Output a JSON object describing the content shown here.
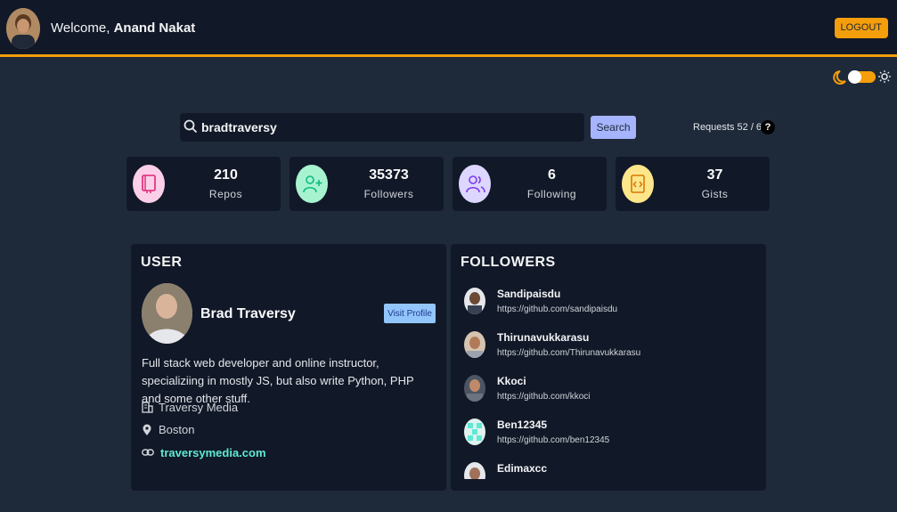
{
  "header": {
    "welcome_prefix": "Welcome,",
    "user_name": "Anand Nakat",
    "logout_label": "LOGOUT"
  },
  "theme": {
    "mode": "dark",
    "accent": "#f59e0b"
  },
  "search": {
    "value": "bradtraversy",
    "button_label": "Search",
    "requests_text": "Requests 52 / 60",
    "help_label": "?"
  },
  "stats": [
    {
      "value": "210",
      "label": "Repos",
      "icon": "repo-book-icon",
      "color": "#fbcfe8"
    },
    {
      "value": "35373",
      "label": "Followers",
      "icon": "user-plus-icon",
      "color": "#a7f3d0"
    },
    {
      "value": "6",
      "label": "Following",
      "icon": "users-icon",
      "color": "#ddd6fe"
    },
    {
      "value": "37",
      "label": "Gists",
      "icon": "code-file-icon",
      "color": "#fde68a"
    }
  ],
  "user": {
    "title": "USER",
    "name": "Brad Traversy",
    "visit_label": "Visit Profile",
    "bio": "Full stack web developer and online instructor, specializiing in mostly JS, but also write Python, PHP and some other stuff.",
    "company": "Traversy Media",
    "location": "Boston",
    "blog": "traversymedia.com"
  },
  "followers": {
    "title": "FOLLOWERS",
    "items": [
      {
        "name": "Sandipaisdu",
        "url": "https://github.com/sandipaisdu"
      },
      {
        "name": "Thirunavukkarasu",
        "url": "https://github.com/Thirunavukkarasu"
      },
      {
        "name": "Kkoci",
        "url": "https://github.com/kkoci"
      },
      {
        "name": "Ben12345",
        "url": "https://github.com/ben12345"
      },
      {
        "name": "Edimaxcc",
        "url": ""
      }
    ]
  }
}
